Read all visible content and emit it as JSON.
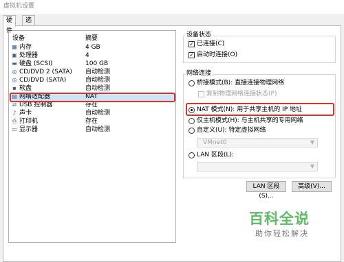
{
  "window": {
    "title": "虚拟机设置"
  },
  "tabs": [
    {
      "label": "硬件",
      "active": true
    },
    {
      "label": "选项",
      "active": false
    }
  ],
  "device_list": {
    "columns": {
      "device": "设备",
      "summary": "摘要"
    },
    "rows": [
      {
        "icon": "memory-icon",
        "name": "内存",
        "summary": "4 GB"
      },
      {
        "icon": "cpu-icon",
        "name": "处理器",
        "summary": "4"
      },
      {
        "icon": "harddisk-icon",
        "name": "硬盘 (SCSI)",
        "summary": "100 GB"
      },
      {
        "icon": "cdrom-icon",
        "name": "CD/DVD 2 (SATA)",
        "summary": "自动检测"
      },
      {
        "icon": "cdrom-icon",
        "name": "CD/DVD (SATA)",
        "summary": "自动检测"
      },
      {
        "icon": "floppy-icon",
        "name": "软盘",
        "summary": "自动检测"
      },
      {
        "icon": "network-icon",
        "name": "网络适配器",
        "summary": "NAT",
        "selected": true
      },
      {
        "icon": "usb-icon",
        "name": "USB 控制器",
        "summary": "存在"
      },
      {
        "icon": "sound-icon",
        "name": "声卡",
        "summary": "自动检测"
      },
      {
        "icon": "printer-icon",
        "name": "打印机",
        "summary": "存在"
      },
      {
        "icon": "display-icon",
        "name": "显示器",
        "summary": "自动检测"
      }
    ]
  },
  "device_status": {
    "title": "设备状态",
    "connected": {
      "label": "已连接(C)",
      "checked": true
    },
    "connect_at_power_on": {
      "label": "启动时连接(O)",
      "checked": true
    }
  },
  "network_connection": {
    "title": "网络连接",
    "bridged": {
      "label": "桥接模式(B): 直接连接物理网络",
      "selected": false
    },
    "replicate": {
      "label": "复制物理网络连接状态(P)",
      "checked": false
    },
    "nat": {
      "label": "NAT 模式(N): 用于共享主机的 IP 地址",
      "selected": true
    },
    "host_only": {
      "label": "仅主机模式(H): 与主机共享的专用网络",
      "selected": false
    },
    "custom": {
      "label": "自定义(U): 特定虚拟网络",
      "selected": false
    },
    "custom_select": {
      "value": "VMnet0"
    },
    "lan_segment": {
      "label": "LAN 区段(L):",
      "selected": false
    },
    "lan_select": {
      "value": ""
    }
  },
  "buttons": {
    "lan_segments": "LAN 区段(S)...",
    "advanced": "高级(V)..."
  },
  "watermark": {
    "title": "百科全说",
    "subtitle": "助你轻松解决"
  },
  "colors": {
    "highlight": "#e0302a",
    "selection": "#cce4f7",
    "watermark": "#5dbb63"
  }
}
